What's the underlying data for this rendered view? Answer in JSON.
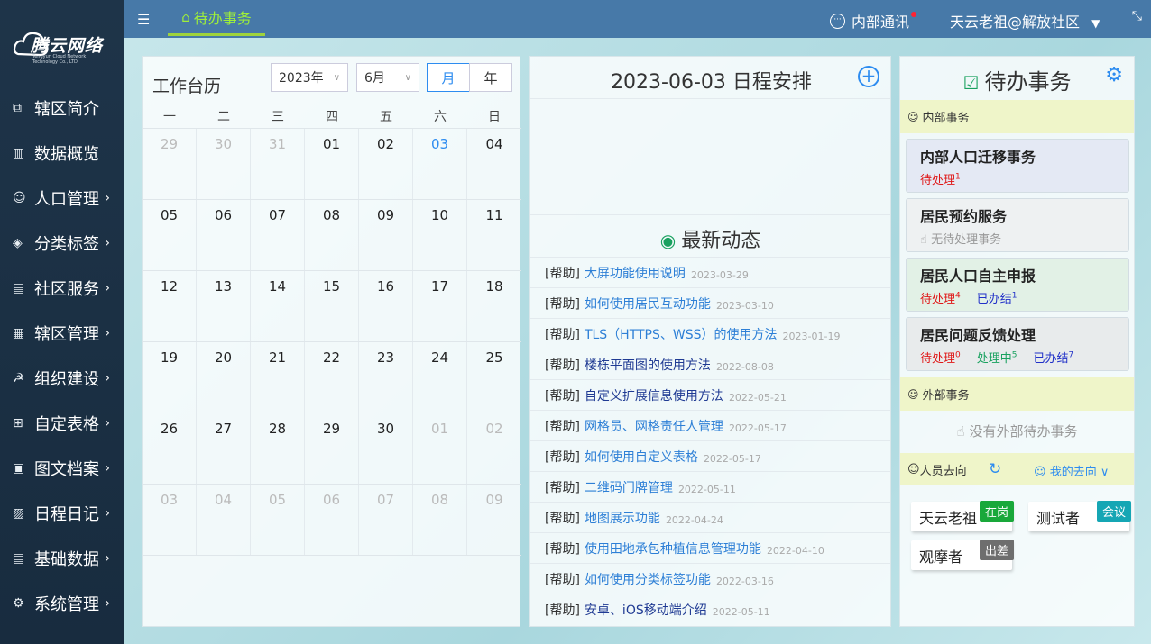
{
  "logo": {
    "name": "腾云网络",
    "sub": "Tengyun Cloud Network Technology Co., LTD"
  },
  "nav": [
    {
      "label": "辖区简介",
      "icon": "⧉",
      "arrow": ""
    },
    {
      "label": "数据概览",
      "icon": "▥",
      "arrow": ""
    },
    {
      "label": "人口管理",
      "icon": "☺",
      "arrow": "›"
    },
    {
      "label": "分类标签",
      "icon": "◈",
      "arrow": "›"
    },
    {
      "label": "社区服务",
      "icon": "▤",
      "arrow": "›"
    },
    {
      "label": "辖区管理",
      "icon": "▦",
      "arrow": "›"
    },
    {
      "label": "组织建设",
      "icon": "☭",
      "arrow": "›"
    },
    {
      "label": "自定表格",
      "icon": "⊞",
      "arrow": "›"
    },
    {
      "label": "图文档案",
      "icon": "▣",
      "arrow": "›"
    },
    {
      "label": "日程日记",
      "icon": "▨",
      "arrow": "›"
    },
    {
      "label": "基础数据",
      "icon": "▤",
      "arrow": "›"
    },
    {
      "label": "系统管理",
      "icon": "⚙",
      "arrow": "›"
    }
  ],
  "topbar": {
    "tab": "待办事务",
    "notice": "内部通讯",
    "user": "天云老祖@解放社区"
  },
  "calendar": {
    "title": "工作台历",
    "year": "2023年",
    "month": "6月",
    "view_month": "月",
    "view_year": "年",
    "weekdays": [
      "一",
      "二",
      "三",
      "四",
      "五",
      "六",
      "日"
    ],
    "rows": [
      [
        [
          "29",
          1
        ],
        [
          "30",
          1
        ],
        [
          "31",
          1
        ],
        [
          "01",
          0
        ],
        [
          "02",
          0
        ],
        [
          "03",
          2
        ],
        [
          "04",
          0
        ]
      ],
      [
        [
          "05",
          0
        ],
        [
          "06",
          0
        ],
        [
          "07",
          0
        ],
        [
          "08",
          0
        ],
        [
          "09",
          0
        ],
        [
          "10",
          0
        ],
        [
          "11",
          0
        ]
      ],
      [
        [
          "12",
          0
        ],
        [
          "13",
          0
        ],
        [
          "14",
          0
        ],
        [
          "15",
          0
        ],
        [
          "16",
          0
        ],
        [
          "17",
          0
        ],
        [
          "18",
          0
        ]
      ],
      [
        [
          "19",
          0
        ],
        [
          "20",
          0
        ],
        [
          "21",
          0
        ],
        [
          "22",
          0
        ],
        [
          "23",
          0
        ],
        [
          "24",
          0
        ],
        [
          "25",
          0
        ]
      ],
      [
        [
          "26",
          0
        ],
        [
          "27",
          0
        ],
        [
          "28",
          0
        ],
        [
          "29",
          0
        ],
        [
          "30",
          0
        ],
        [
          "01",
          1
        ],
        [
          "02",
          1
        ]
      ],
      [
        [
          "03",
          1
        ],
        [
          "04",
          1
        ],
        [
          "05",
          1
        ],
        [
          "06",
          1
        ],
        [
          "07",
          1
        ],
        [
          "08",
          1
        ],
        [
          "09",
          1
        ]
      ]
    ]
  },
  "schedule": {
    "title": "2023-06-03 日程安排"
  },
  "news": {
    "title": "最新动态",
    "items": [
      {
        "tag": "[帮助]",
        "title": "大屏功能使用说明",
        "date": "2023-03-29",
        "visited": false
      },
      {
        "tag": "[帮助]",
        "title": "如何使用居民互动功能",
        "date": "2023-03-10",
        "visited": false
      },
      {
        "tag": "[帮助]",
        "title": "TLS（HTTPS、WSS）的使用方法",
        "date": "2023-01-19",
        "visited": false
      },
      {
        "tag": "[帮助]",
        "title": "楼栋平面图的使用方法",
        "date": "2022-08-08",
        "visited": true
      },
      {
        "tag": "[帮助]",
        "title": "自定义扩展信息使用方法",
        "date": "2022-05-21",
        "visited": true
      },
      {
        "tag": "[帮助]",
        "title": "网格员、网格责任人管理",
        "date": "2022-05-17",
        "visited": false
      },
      {
        "tag": "[帮助]",
        "title": "如何使用自定义表格",
        "date": "2022-05-17",
        "visited": false
      },
      {
        "tag": "[帮助]",
        "title": "二维码门牌管理",
        "date": "2022-05-11",
        "visited": false
      },
      {
        "tag": "[帮助]",
        "title": "地图展示功能",
        "date": "2022-04-24",
        "visited": false
      },
      {
        "tag": "[帮助]",
        "title": "使用田地承包种植信息管理功能",
        "date": "2022-04-10",
        "visited": false
      },
      {
        "tag": "[帮助]",
        "title": "如何使用分类标签功能",
        "date": "2022-03-16",
        "visited": false
      },
      {
        "tag": "[帮助]",
        "title": "安卓、iOS移动端介绍",
        "date": "2022-05-11",
        "visited": true
      }
    ]
  },
  "todo": {
    "title": "待办事务",
    "internal_label": "内部事务",
    "external_label": "外部事务",
    "no_external": "没有外部待办事务",
    "tasks": [
      {
        "name": "内部人口迁移事务",
        "bg": "#e4e9f4",
        "status": [
          {
            "text": "待处理",
            "count": "1",
            "cls": "red"
          }
        ]
      },
      {
        "name": "居民预约服务",
        "bg": "#eef1f2",
        "status": [
          {
            "text": "无待处理事务",
            "count": "",
            "cls": "grey"
          }
        ]
      },
      {
        "name": "居民人口自主申报",
        "bg": "#e2f1e6",
        "status": [
          {
            "text": "待处理",
            "count": "4",
            "cls": "red"
          },
          {
            "text": "已办结",
            "count": "1",
            "cls": "blue"
          }
        ]
      },
      {
        "name": "居民问题反馈处理",
        "bg": "#e8ebec",
        "status": [
          {
            "text": "待处理",
            "count": "0",
            "cls": "red"
          },
          {
            "text": "处理中",
            "count": "5",
            "cls": "green"
          },
          {
            "text": "已办结",
            "count": "7",
            "cls": "blue"
          }
        ]
      }
    ],
    "direction_label": "人员去向",
    "my_direction": "我的去向",
    "people": [
      {
        "name": "天云老祖",
        "status": "在岗",
        "cls": "on-duty"
      },
      {
        "name": "测试者",
        "status": "会议",
        "cls": "meeting"
      },
      {
        "name": "观摩者",
        "status": "出差",
        "cls": "trip"
      }
    ]
  }
}
